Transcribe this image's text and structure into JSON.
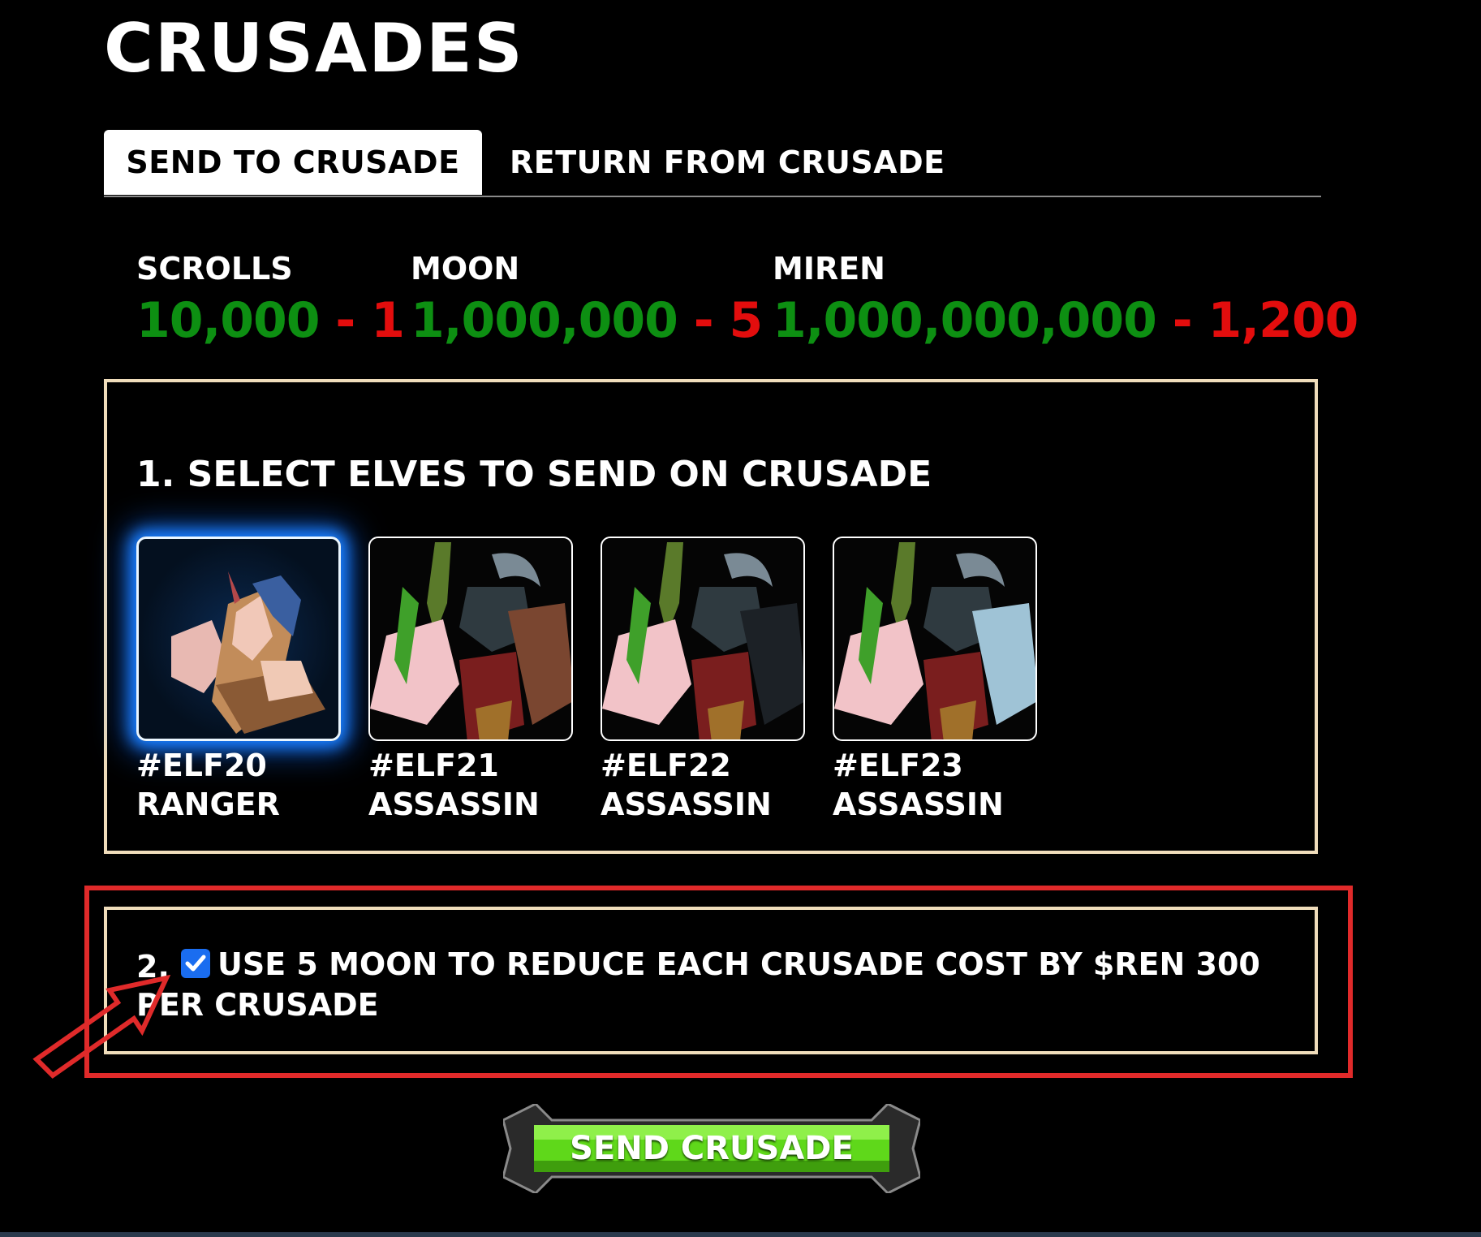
{
  "page": {
    "title": "CRUSADES"
  },
  "tabs": [
    {
      "label": "SEND TO CRUSADE",
      "active": true
    },
    {
      "label": "RETURN FROM CRUSADE",
      "active": false
    }
  ],
  "stats": [
    {
      "label": "SCROLLS",
      "amount": "10,000",
      "separator": " - ",
      "cost": "1"
    },
    {
      "label": "MOON",
      "amount": "1,000,000",
      "separator": " - ",
      "cost": "5"
    },
    {
      "label": "MIREN",
      "amount": "1,000,000,000",
      "separator": " - ",
      "cost": "1,200"
    }
  ],
  "select_section": {
    "title": "1. SELECT ELVES TO SEND ON CRUSADE"
  },
  "elves": [
    {
      "id": "#ELF20",
      "class": "RANGER",
      "selected": true
    },
    {
      "id": "#ELF21",
      "class": "ASSASSIN",
      "selected": false
    },
    {
      "id": "#ELF22",
      "class": "ASSASSIN",
      "selected": false
    },
    {
      "id": "#ELF23",
      "class": "ASSASSIN",
      "selected": false
    }
  ],
  "option_section": {
    "number": "2.",
    "checked": true,
    "text": "USE 5 MOON TO REDUCE EACH CRUSADE COST BY $REN 300 PER CRUSADE"
  },
  "send_button": {
    "label": "SEND CRUSADE"
  },
  "colors": {
    "amount": "#0d8f12",
    "cost": "#e30d0d",
    "highlight": "#e02a2a",
    "box_border": "#f0ddbb",
    "checkbox": "#1a6df0",
    "button": "#5fd81a"
  }
}
